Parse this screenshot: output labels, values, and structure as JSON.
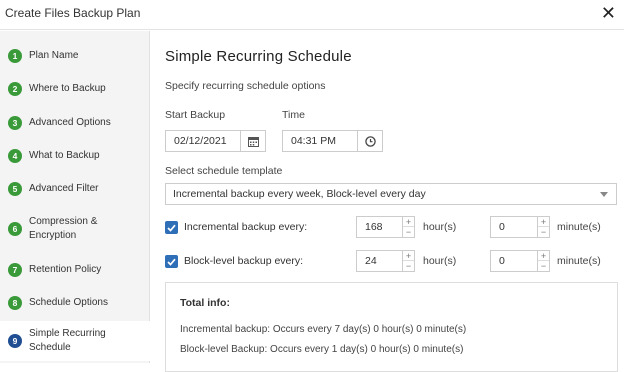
{
  "window": {
    "title": "Create Files Backup Plan",
    "close_icon": "close-icon"
  },
  "colors": {
    "step_done": "#3a9a3a",
    "step_active": "#1f4e93",
    "checkbox": "#2f6fb8"
  },
  "sidebar": {
    "steps": [
      {
        "num": "1",
        "label": "Plan Name"
      },
      {
        "num": "2",
        "label": "Where to Backup"
      },
      {
        "num": "3",
        "label": "Advanced Options"
      },
      {
        "num": "4",
        "label": "What to Backup"
      },
      {
        "num": "5",
        "label": "Advanced Filter"
      },
      {
        "num": "6",
        "label": "Compression & Encryption"
      },
      {
        "num": "7",
        "label": "Retention Policy"
      },
      {
        "num": "8",
        "label": "Schedule Options"
      },
      {
        "num": "9",
        "label": "Simple Recurring Schedule",
        "active": true
      }
    ]
  },
  "main": {
    "heading": "Simple Recurring Schedule",
    "subheading": "Specify recurring schedule options",
    "start_backup": {
      "label": "Start Backup",
      "value": "02/12/2021",
      "icon": "calendar-icon"
    },
    "time": {
      "label": "Time",
      "value": "04:31 PM",
      "icon": "clock-icon"
    },
    "template": {
      "label": "Select schedule template",
      "value": "Incremental backup every week, Block-level every day"
    },
    "incremental": {
      "checked": true,
      "label": "Incremental backup every:",
      "hours": "168",
      "hours_unit": "hour(s)",
      "minutes": "0",
      "minutes_unit": "minute(s)"
    },
    "block_level": {
      "checked": true,
      "label": "Block-level backup every:",
      "hours": "24",
      "hours_unit": "hour(s)",
      "minutes": "0",
      "minutes_unit": "minute(s)"
    },
    "total_info": {
      "title": "Total info:",
      "line1": "Incremental backup: Occurs every 7 day(s) 0 hour(s) 0 minute(s)",
      "line2": "Block-level Backup: Occurs every 1 day(s) 0 hour(s) 0 minute(s)"
    },
    "spinner_up": "+",
    "spinner_down": "−"
  }
}
